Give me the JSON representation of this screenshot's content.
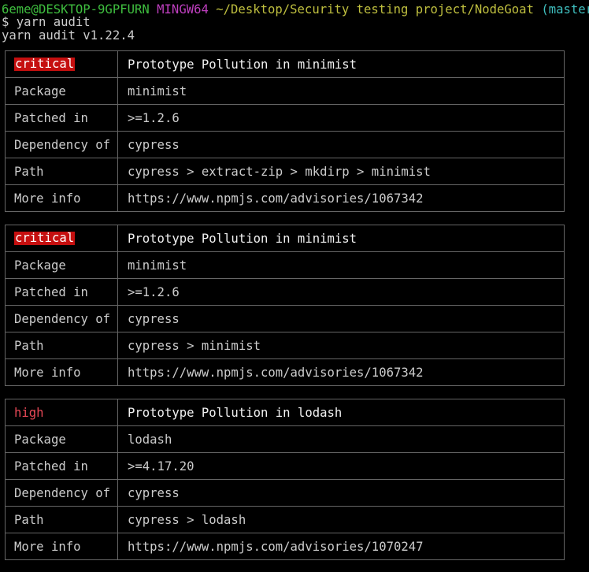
{
  "prompt": {
    "user_host": "6eme@DESKTOP-9GPFURN",
    "env": "MINGW64",
    "path": "~/Desktop/Security testing project/NodeGoat",
    "branch": "(master)"
  },
  "command": "$ yarn audit",
  "version_line": "yarn audit v1.22.4",
  "colors": {
    "critical_bg": "#c50f0f",
    "high_text": "#e74856",
    "prompt_green": "#3fbf3f",
    "prompt_magenta": "#bf3fbf",
    "prompt_yellow": "#bfbf3f",
    "prompt_cyan": "#3fbfbf"
  },
  "labels": {
    "package": "Package",
    "patched_in": "Patched in",
    "dependency_of": "Dependency of",
    "path": "Path",
    "more_info": "More info"
  },
  "advisories": [
    {
      "severity": "critical",
      "title": "Prototype Pollution in minimist",
      "package": "minimist",
      "patched_in": ">=1.2.6",
      "dependency_of": "cypress",
      "path": "cypress > extract-zip > mkdirp > minimist",
      "more_info": "https://www.npmjs.com/advisories/1067342"
    },
    {
      "severity": "critical",
      "title": "Prototype Pollution in minimist",
      "package": "minimist",
      "patched_in": ">=1.2.6",
      "dependency_of": "cypress",
      "path": "cypress > minimist",
      "more_info": "https://www.npmjs.com/advisories/1067342"
    },
    {
      "severity": "high",
      "title": "Prototype Pollution in lodash",
      "package": "lodash",
      "patched_in": ">=4.17.20",
      "dependency_of": "cypress",
      "path": "cypress > lodash",
      "more_info": "https://www.npmjs.com/advisories/1070247"
    }
  ]
}
